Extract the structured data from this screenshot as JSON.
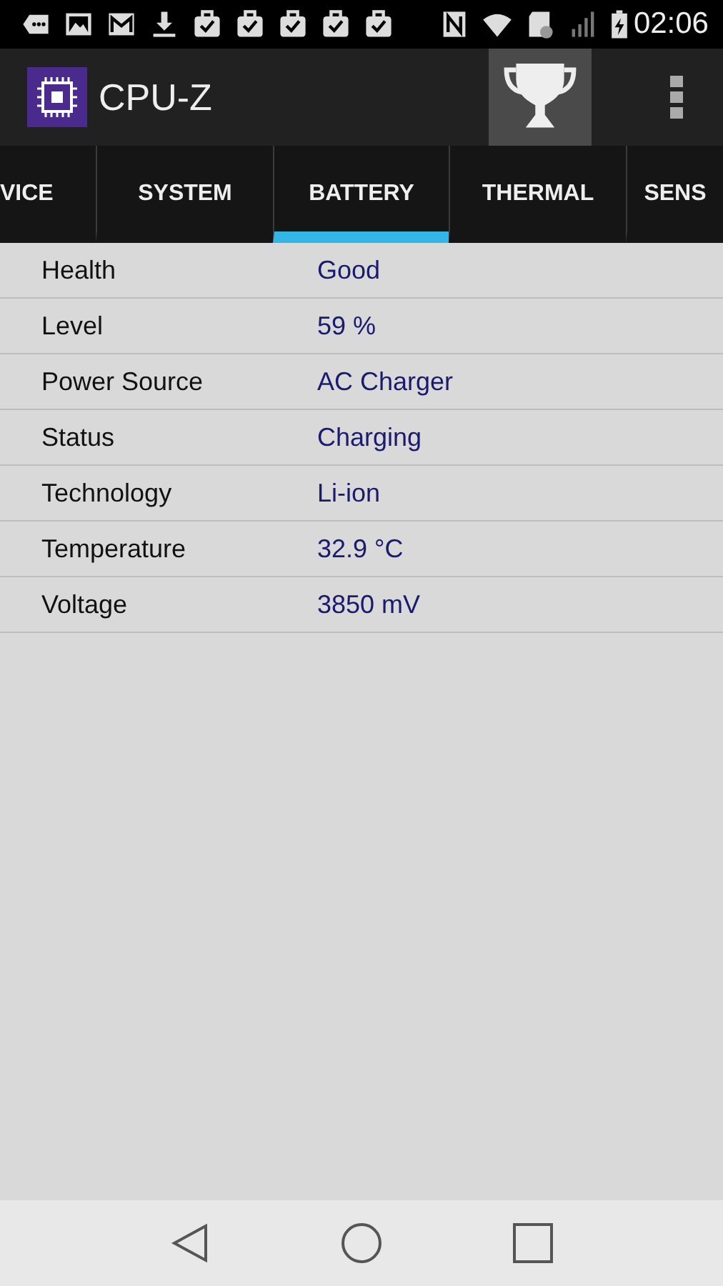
{
  "status_bar": {
    "time": "02:06"
  },
  "app_bar": {
    "title": "CPU-Z"
  },
  "tabs": [
    {
      "label": "VICE",
      "selected": false
    },
    {
      "label": "SYSTEM",
      "selected": false
    },
    {
      "label": "BATTERY",
      "selected": true
    },
    {
      "label": "THERMAL",
      "selected": false
    },
    {
      "label": "SENS",
      "selected": false
    }
  ],
  "rows": [
    {
      "label": "Health",
      "value": "Good"
    },
    {
      "label": "Level",
      "value": "59 %"
    },
    {
      "label": "Power Source",
      "value": "AC Charger"
    },
    {
      "label": "Status",
      "value": "Charging"
    },
    {
      "label": "Technology",
      "value": "Li-ion"
    },
    {
      "label": "Temperature",
      "value": "32.9 °C"
    },
    {
      "label": "Voltage",
      "value": "3850 mV"
    }
  ]
}
